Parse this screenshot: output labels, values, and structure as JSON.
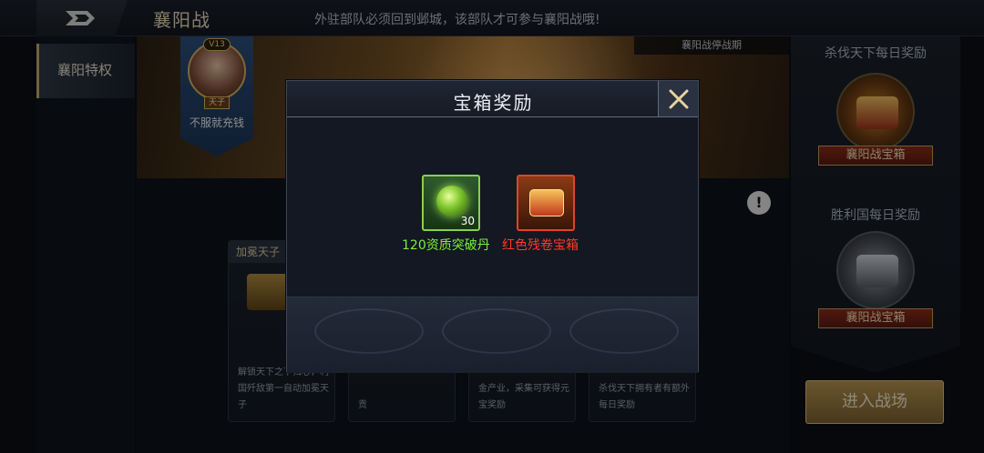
{
  "topbar": {
    "title": "襄阳战",
    "notice": "外驻部队必须回到邺城，该部队才可参与襄阳战哦!"
  },
  "sidebar": {
    "tabs": [
      {
        "label": "襄阳特权"
      }
    ]
  },
  "banner": {
    "status_tag": "襄阳战停战期",
    "emperor": {
      "vip": "V13",
      "rank": "天子",
      "name": "不服就充钱"
    }
  },
  "cards": [
    {
      "title": "加冕天子",
      "desc": "解锁天下之下归心，利国歼敌第一自动加冕天子"
    },
    {
      "title": "",
      "desc": "贡"
    },
    {
      "title": "",
      "desc": "金产业，采集可获得元宝奖励"
    },
    {
      "title": "",
      "desc": "杀伐天下拥有者有额外每日奖励"
    }
  ],
  "right_panel": {
    "daily_kill": {
      "title": "杀伐天下每日奖励",
      "chest_label": "襄阳战宝箱"
    },
    "daily_win": {
      "title": "胜利国每日奖励",
      "chest_label": "襄阳战宝箱"
    },
    "enter_button": "进入战场"
  },
  "modal": {
    "title": "宝箱奖励",
    "items": [
      {
        "name": "120资质突破丹",
        "count": "30",
        "color": "#7cf03a",
        "icon": "green-pill-icon"
      },
      {
        "name": "红色残卷宝箱",
        "count": "",
        "color": "#ff3a2a",
        "icon": "red-treasure-chest-icon"
      }
    ]
  },
  "colors": {
    "accent_gold": "#c9a86a",
    "rare_green": "#7cf03a",
    "rare_red": "#ff3a2a"
  }
}
